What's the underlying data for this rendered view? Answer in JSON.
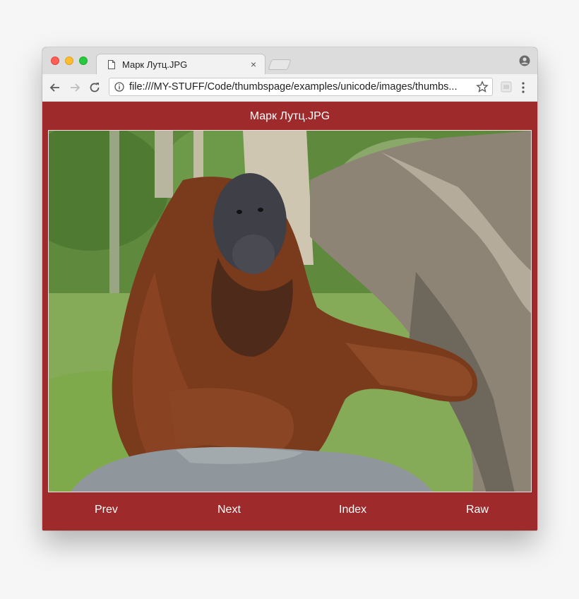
{
  "browser": {
    "tab_title": "Марк Лутц.JPG",
    "tab_close": "×",
    "url": "file:///MY-STUFF/Code/thumbspage/examples/unicode/images/thumbs..."
  },
  "page": {
    "title": "Марк Лутц.JPG",
    "nav": {
      "prev": "Prev",
      "next": "Next",
      "index": "Index",
      "raw": "Raw"
    }
  },
  "colors": {
    "page_background": "#9e2a2b",
    "nav_text": "#ffffff"
  }
}
